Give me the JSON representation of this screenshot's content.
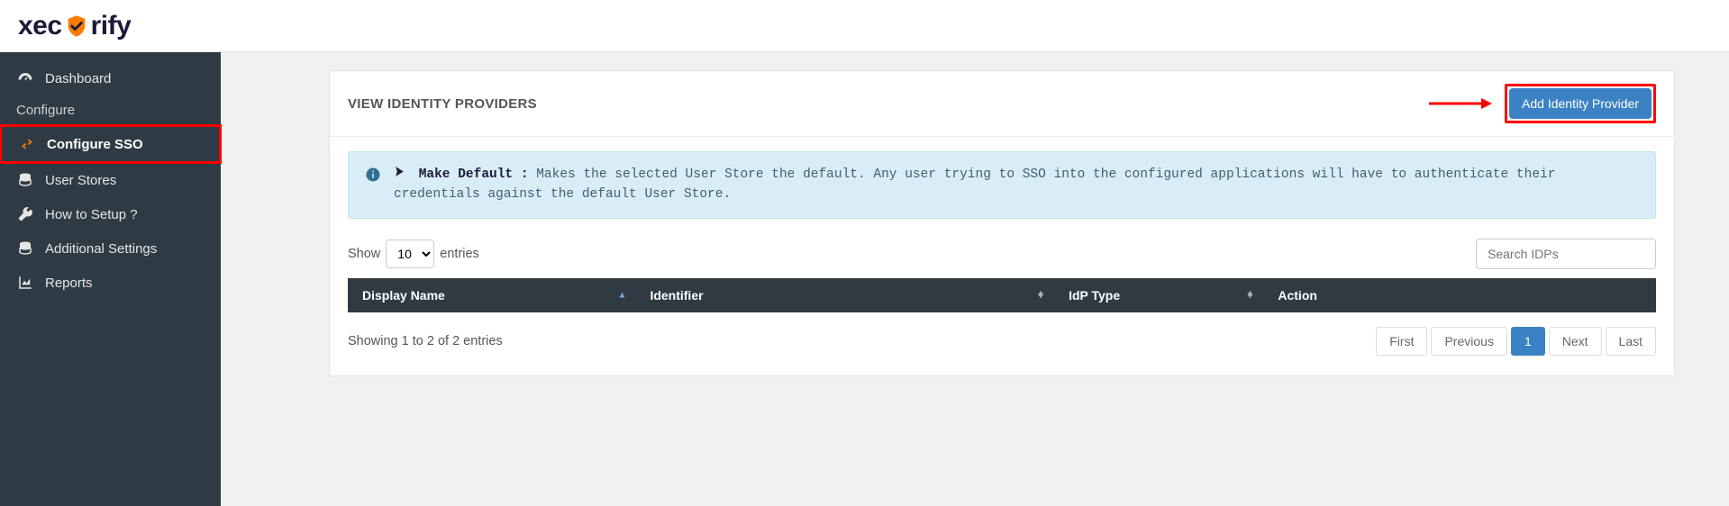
{
  "brand": {
    "name": "xecurify",
    "part1": "xec",
    "part2": "rify"
  },
  "sidebar": {
    "items": [
      {
        "label": "Dashboard",
        "icon": "gauge-icon"
      },
      {
        "label": "Configure",
        "icon": "",
        "subheader": true
      },
      {
        "label": "Configure SSO",
        "icon": "swap-icon",
        "active": true
      },
      {
        "label": "User Stores",
        "icon": "database-icon"
      },
      {
        "label": "How to Setup ?",
        "icon": "wrench-icon"
      },
      {
        "label": "Additional Settings",
        "icon": "database-icon"
      },
      {
        "label": "Reports",
        "icon": "chart-icon"
      }
    ]
  },
  "panel": {
    "title": "VIEW IDENTITY PROVIDERS",
    "add_button": "Add Identity Provider"
  },
  "info": {
    "lead": "Make Default :",
    "body": "Makes the selected User Store the default. Any user trying to SSO into the configured applications will have to authenticate their credentials against the default User Store."
  },
  "table": {
    "show_prefix": "Show",
    "show_suffix": "entries",
    "page_size": "10",
    "search_placeholder": "Search IDPs",
    "columns": [
      "Display Name",
      "Identifier",
      "IdP Type",
      "Action"
    ],
    "info_text": "Showing 1 to 2 of 2 entries",
    "pagination": {
      "first": "First",
      "previous": "Previous",
      "pages": [
        "1"
      ],
      "next": "Next",
      "last": "Last"
    }
  }
}
